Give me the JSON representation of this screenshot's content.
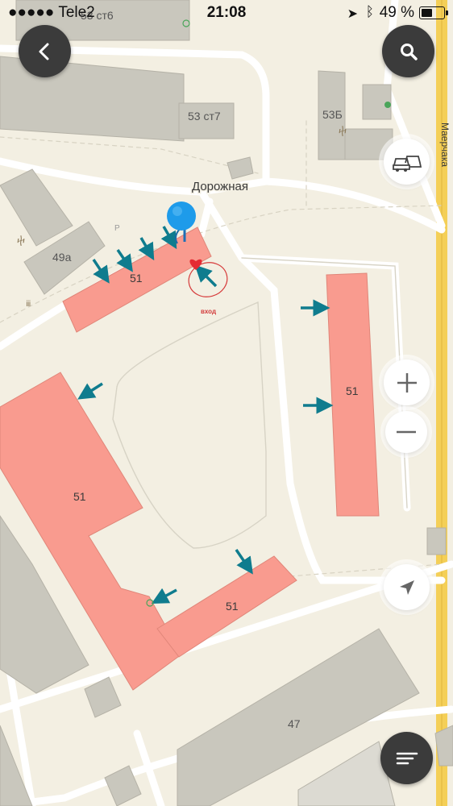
{
  "status_bar": {
    "carrier": "●●●●● Tele2",
    "time": "21:08",
    "battery_percent": "49 %",
    "battery_level": 0.49
  },
  "map": {
    "street_labels": {
      "dorozhnaya": "Дорожная",
      "mayerchaka": "Маерчака"
    },
    "building_labels": {
      "b53st6": "53 ст6",
      "b53st7": "53 ст7",
      "b53b": "53Б",
      "b49a": "49а",
      "b51_top": "51",
      "b51_right": "51",
      "b51_left": "51",
      "b51_bottom": "51",
      "b47": "47"
    },
    "entrance_label": "вход",
    "colors": {
      "background": "#f3efe2",
      "highlight_building": "#f99b8f",
      "gray_building": "#c9c7bd",
      "arrow": "#0f7c8e",
      "road": "#ffffff",
      "highway": "#f4cf57",
      "pin": "#1e9bea"
    }
  },
  "controls": {
    "back_icon": "chevron-left-icon",
    "search_icon": "magnifier-icon",
    "traffic_icon": "traffic-cars-icon",
    "zoom_in_icon": "plus-icon",
    "zoom_out_icon": "minus-icon",
    "locate_icon": "navigation-arrow-icon",
    "menu_icon": "menu-lines-icon"
  }
}
